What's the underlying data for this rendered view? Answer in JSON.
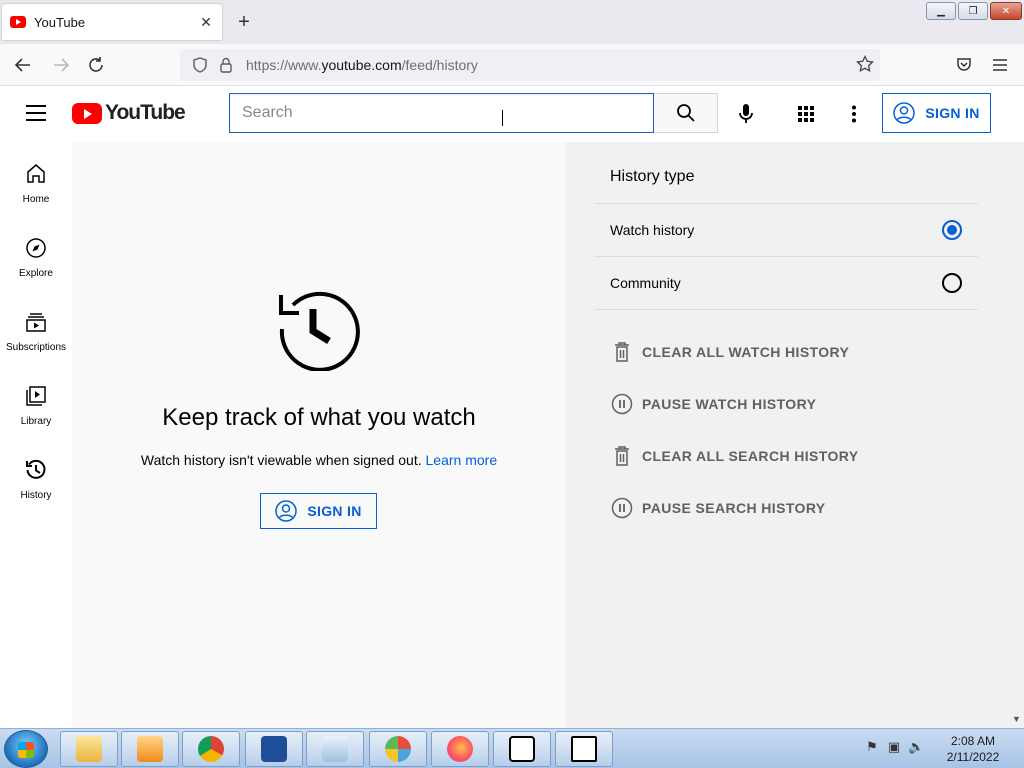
{
  "browser": {
    "tab_title": "YouTube",
    "tab_close": "✕",
    "new_tab": "+",
    "url_prefix": "https://www.",
    "url_domain": "youtube.com",
    "url_path": "/feed/history"
  },
  "header": {
    "logo_text": "YouTube",
    "search_placeholder": "Search",
    "sign_in": "SIGN IN"
  },
  "guide": {
    "items": [
      {
        "label": "Home"
      },
      {
        "label": "Explore"
      },
      {
        "label": "Subscriptions"
      },
      {
        "label": "Library"
      },
      {
        "label": "History"
      }
    ]
  },
  "main": {
    "title": "Keep track of what you watch",
    "subtitle": "Watch history isn't viewable when signed out.",
    "learn_more": "Learn more",
    "sign_in": "SIGN IN"
  },
  "panel": {
    "title": "History type",
    "options": [
      {
        "label": "Watch history",
        "selected": true
      },
      {
        "label": "Community",
        "selected": false
      }
    ],
    "actions": [
      {
        "label": "CLEAR ALL WATCH HISTORY",
        "icon": "trash-icon"
      },
      {
        "label": "PAUSE WATCH HISTORY",
        "icon": "pause-icon"
      },
      {
        "label": "CLEAR ALL SEARCH HISTORY",
        "icon": "trash-icon"
      },
      {
        "label": "PAUSE SEARCH HISTORY",
        "icon": "pause-icon"
      }
    ]
  },
  "taskbar": {
    "time": "2:08 AM",
    "date": "2/11/2022"
  },
  "colors": {
    "accent": "#065fd4",
    "brand": "#ff0000"
  }
}
